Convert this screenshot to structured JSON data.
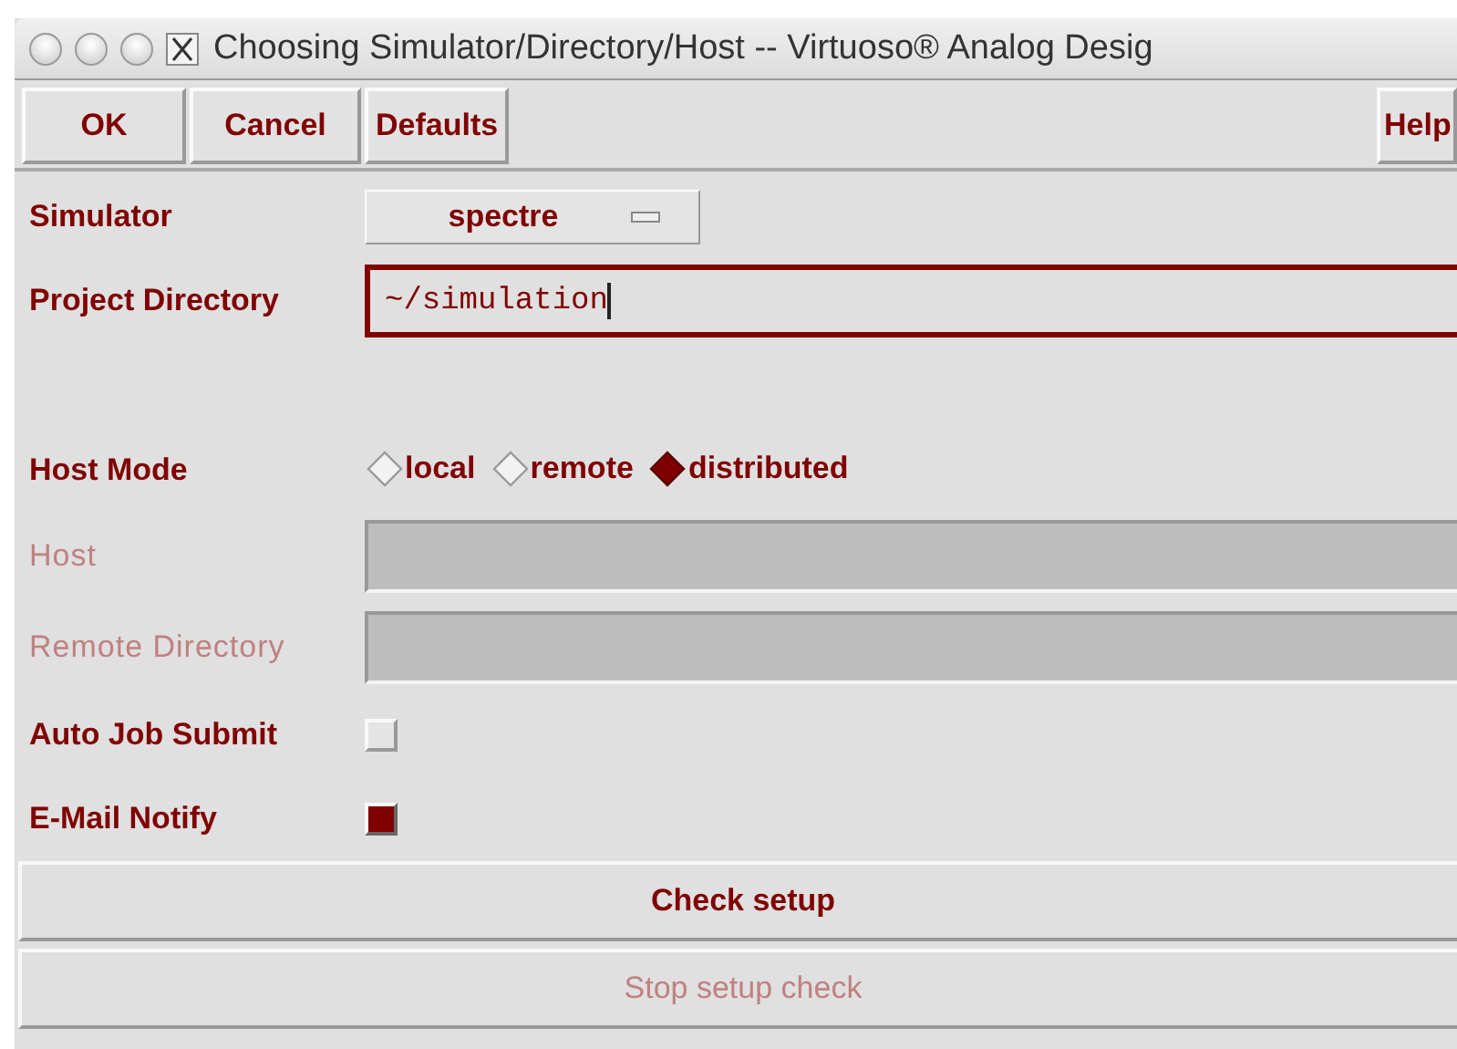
{
  "window": {
    "title": "Choosing Simulator/Directory/Host -- Virtuoso® Analog Desig"
  },
  "buttons": [
    {
      "label": "OK"
    },
    {
      "label": "Cancel"
    },
    {
      "label": "Defaults"
    },
    {
      "label": "Help"
    }
  ],
  "rows": [
    {
      "kind": "cycle",
      "label": "Simulator",
      "value": "spectre"
    },
    {
      "kind": "text",
      "label": "Project Directory",
      "value": "~/simulation",
      "disabled": false
    },
    {
      "kind": "radio",
      "label": "Host Mode",
      "options": [
        {
          "label": "local",
          "selected": false
        },
        {
          "label": "remote",
          "selected": false
        },
        {
          "label": "distributed",
          "selected": true
        }
      ]
    },
    {
      "kind": "text",
      "label": "Host",
      "disabled": true
    },
    {
      "kind": "text",
      "label": "Remote Directory",
      "disabled": true
    },
    {
      "kind": "checkbox",
      "label": "Auto Job Submit",
      "checked": false
    },
    {
      "kind": "checkbox",
      "label": "E-Mail Notify",
      "checked": true
    }
  ],
  "actions": [
    {
      "label": "Check setup",
      "disabled": false
    },
    {
      "label": "Stop setup check",
      "disabled": true
    }
  ]
}
